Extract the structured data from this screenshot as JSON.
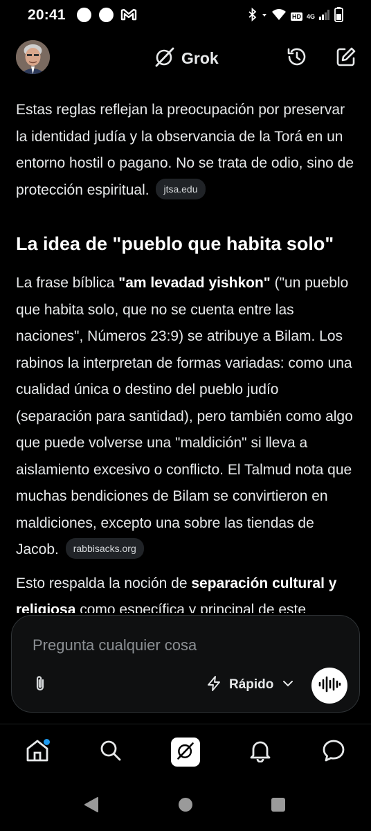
{
  "status_bar": {
    "time": "20:41",
    "hd_label": "HD",
    "network_label": "4G",
    "icons": [
      "notification-dot-icon",
      "notification-dot-icon",
      "gmail-icon",
      "bluetooth-icon",
      "data-arrows-icon",
      "wifi-icon",
      "signal-icon",
      "battery-icon"
    ]
  },
  "header": {
    "app_name": "Grok",
    "icons": [
      "grok-logo-icon",
      "history-icon",
      "new-chat-icon"
    ]
  },
  "content": {
    "para1": "Estas reglas reflejan la preocupación por preservar la identidad judía y la observancia de la Torá en un entorno hostil o pagano. No se trata de odio, sino de protección espiritual.",
    "cite1": "jtsa.edu",
    "heading": "La idea de \"pueblo que habita solo\"",
    "para2_pre": "La frase bíblica ",
    "para2_bold": "\"am levadad yishkon\"",
    "para2_post": " (\"un pueblo que habita solo, que no se cuenta entre las naciones\", Números 23:9) se atribuye a Bilam. Los rabinos la interpretan de formas variadas: como una cualidad única o destino del pueblo judío (separación para santidad), pero también como algo que puede volverse una \"maldición\" si lleva a aislamiento excesivo o conflicto. El Talmud nota que muchas bendiciones de Bilam se convirtieron en maldiciones, excepto una sobre las tiendas de Jacob.",
    "cite2": "rabbisacks.org",
    "para3_pre": "Esto respalda la noción de ",
    "para3_bold": "separación cultural y religiosa",
    "para3_post": " como específica y principal de este"
  },
  "composer": {
    "placeholder": "Pregunta cualquier cosa",
    "mode_label": "Rápido",
    "icons": [
      "paperclip-icon",
      "lightning-icon",
      "chevron-down-icon",
      "voice-waveform-icon"
    ]
  },
  "bottom_nav": {
    "items": [
      "home",
      "search",
      "grok",
      "notifications",
      "messages"
    ],
    "accent": "#1d9bf0"
  },
  "system_nav": [
    "back",
    "home",
    "recents"
  ]
}
